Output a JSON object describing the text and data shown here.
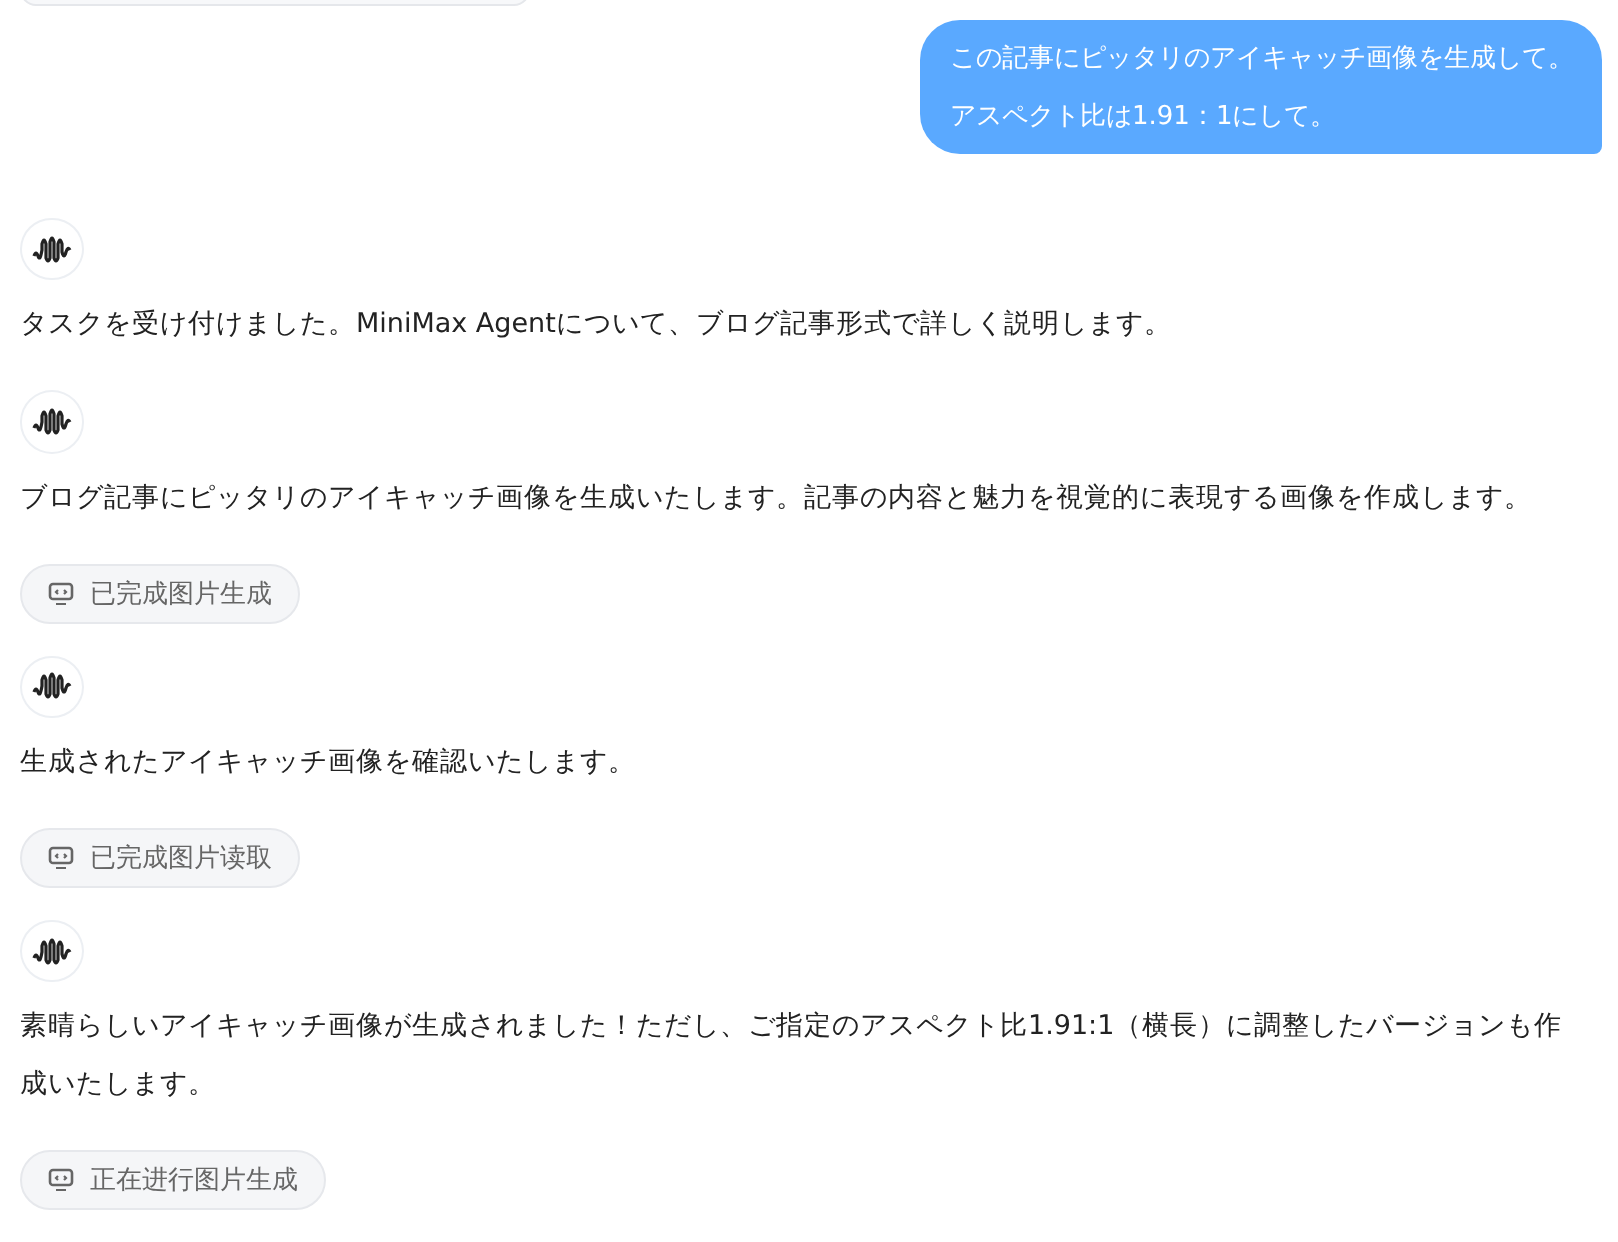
{
  "messages": [
    {
      "kind": "user",
      "lines": [
        "この記事にピッタリのアイキャッチ画像を生成して。",
        "アスペクト比は1.91：1にして。"
      ]
    },
    {
      "kind": "agent",
      "text": "タスクを受け付けました。MiniMax Agentについて、ブログ記事形式で詳しく説明します。"
    },
    {
      "kind": "agent",
      "text": "ブログ記事にピッタリのアイキャッチ画像を生成いたします。記事の内容と魅力を視覚的に表現する画像を作成します。"
    },
    {
      "kind": "tool",
      "text": "已完成图片生成"
    },
    {
      "kind": "agent",
      "text": "生成されたアイキャッチ画像を確認いたします。"
    },
    {
      "kind": "tool",
      "text": "已完成图片读取"
    },
    {
      "kind": "agent",
      "text": "素晴らしいアイキャッチ画像が生成されました！ただし、ご指定のアスペクト比1.91:1（横長）に調整したバージョンも作成いたします。"
    },
    {
      "kind": "tool",
      "text": "正在进行图片生成"
    }
  ]
}
